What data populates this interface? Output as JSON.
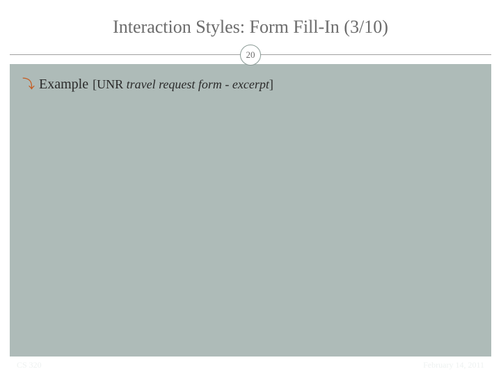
{
  "slide": {
    "title": "Interaction Styles: Form Fill-In (3/10)",
    "page_number": "20",
    "bullet": {
      "label": "Example",
      "detail_prefix": "[UNR ",
      "detail_italic": "travel request form - excerpt",
      "detail_suffix": "]"
    },
    "footer_left": "CS 320",
    "footer_right": "February 14, 2011"
  }
}
